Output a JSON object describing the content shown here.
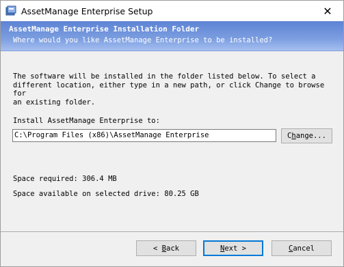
{
  "window": {
    "title": "AssetManage Enterprise Setup",
    "close_symbol": "✕"
  },
  "banner": {
    "title": "AssetManage Enterprise Installation Folder",
    "subtitle": "Where would you like AssetManage Enterprise to be installed?"
  },
  "body": {
    "description": "The software will be installed in the folder listed below. To select a\ndifferent location, either type in a new path, or click Change to browse for\nan existing folder.",
    "install_label": "Install AssetManage Enterprise to:",
    "path_value": "C:\\Program Files (x86)\\AssetManage Enterprise",
    "space_required": "Space required: 306.4 MB",
    "space_available": "Space available on selected drive: 80.25 GB"
  },
  "buttons": {
    "change_prefix": "C",
    "change_accel": "h",
    "change_rest": "ange...",
    "back_arrow": "<",
    "back_accel": "B",
    "back_rest": "ack",
    "next_accel": "N",
    "next_rest": "ext",
    "next_arrow": ">",
    "cancel_accel": "C",
    "cancel_rest": "ancel"
  },
  "icons": {
    "app": "setup-app-icon",
    "close": "close-icon"
  },
  "colors": {
    "banner_gradient_top": "#5d83d4",
    "banner_gradient_bottom": "#a6bff0",
    "default_button_border": "#0078d7"
  }
}
